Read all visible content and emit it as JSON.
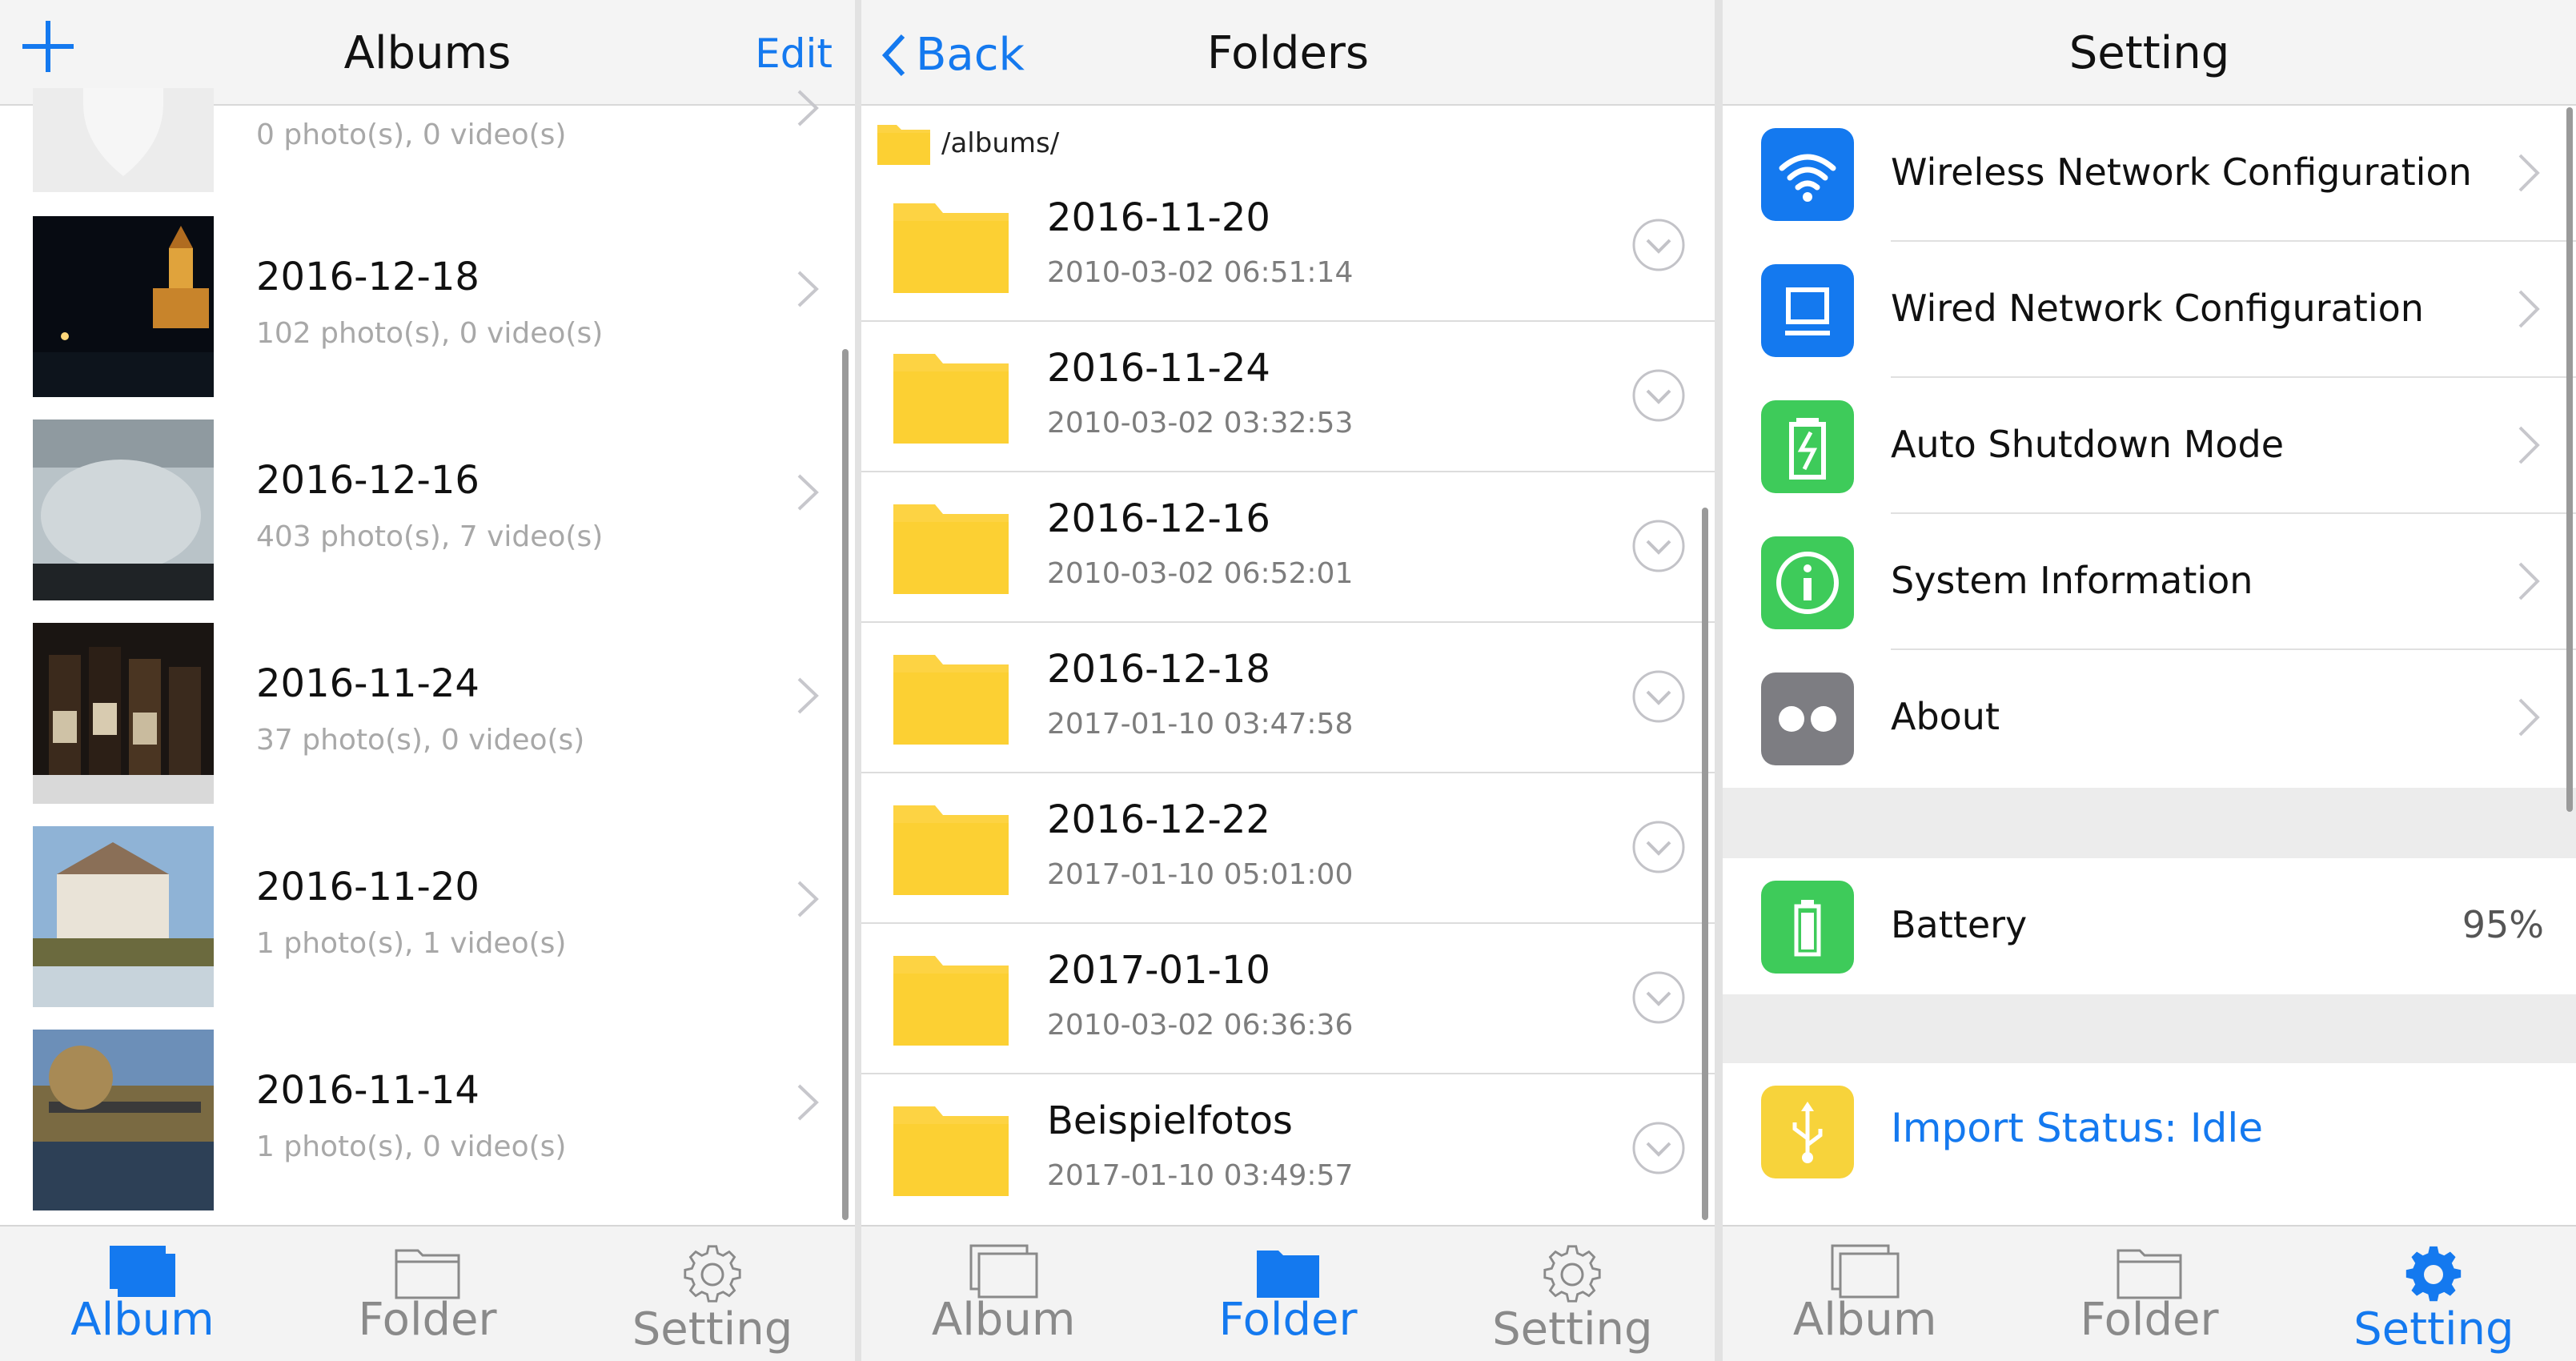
{
  "albums_screen": {
    "title": "Albums",
    "edit_label": "Edit",
    "partial_row_subtitle": "0 photo(s), 0 video(s)",
    "items": [
      {
        "title": "2016-12-18",
        "subtitle": "102 photo(s), 0 video(s)"
      },
      {
        "title": "2016-12-16",
        "subtitle": "403 photo(s), 7 video(s)"
      },
      {
        "title": "2016-11-24",
        "subtitle": "37 photo(s), 0 video(s)"
      },
      {
        "title": "2016-11-20",
        "subtitle": "1 photo(s), 1 video(s)"
      },
      {
        "title": "2016-11-14",
        "subtitle": "1 photo(s), 0 video(s)"
      }
    ]
  },
  "folders_screen": {
    "title": "Folders",
    "back_label": "Back",
    "path": "/albums/",
    "items": [
      {
        "name": "2016-11-20",
        "date": "2010-03-02 06:51:14"
      },
      {
        "name": "2016-11-24",
        "date": "2010-03-02 03:32:53"
      },
      {
        "name": "2016-12-16",
        "date": "2010-03-02 06:52:01"
      },
      {
        "name": "2016-12-18",
        "date": "2017-01-10 03:47:58"
      },
      {
        "name": "2016-12-22",
        "date": "2017-01-10 05:01:00"
      },
      {
        "name": "2017-01-10",
        "date": "2010-03-02 06:36:36"
      },
      {
        "name": "Beispielfotos",
        "date": "2017-01-10 03:49:57"
      }
    ]
  },
  "settings_screen": {
    "title": "Setting",
    "items": [
      {
        "label": "Wireless Network Configuration",
        "icon": "wifi-icon",
        "color": "#1479ef"
      },
      {
        "label": "Wired Network Configuration",
        "icon": "monitor-icon",
        "color": "#1479ef"
      },
      {
        "label": "Auto Shutdown Mode",
        "icon": "battery-charging-icon",
        "color": "#3ecb5a"
      },
      {
        "label": "System Information",
        "icon": "info-icon",
        "color": "#3ecb5a"
      },
      {
        "label": "About",
        "icon": "dots-icon",
        "color": "#7d7d82"
      }
    ],
    "battery": {
      "label": "Battery",
      "value": "95%",
      "color": "#3ecb5a"
    },
    "import_status": {
      "label": "Import Status: Idle",
      "color": "#f7d33b"
    }
  },
  "tabbar": {
    "album": "Album",
    "folder": "Folder",
    "setting": "Setting"
  },
  "colors": {
    "accent": "#1479ef",
    "folder_yellow": "#fdd343",
    "header_bg": "#f4f4f4"
  }
}
